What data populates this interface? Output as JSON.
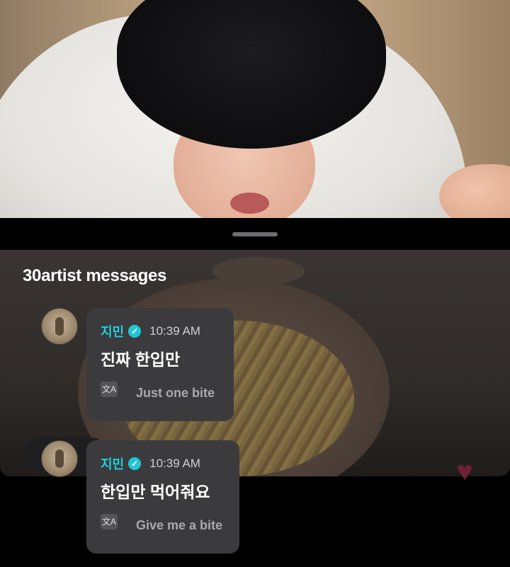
{
  "section": {
    "title": "30artist messages"
  },
  "messages": [
    {
      "sender": "지민",
      "verified_icon": "verified-badge-icon",
      "time": "10:39 AM",
      "text": "진짜 한입만",
      "translate_icon": "translate-icon",
      "translation": "Just one bite"
    },
    {
      "sender": "지민",
      "verified_icon": "verified-badge-icon",
      "time": "10:39 AM",
      "text": "한입만 먹어줘요",
      "translate_icon": "translate-icon",
      "translation": "Give me a bite"
    }
  ],
  "colors": {
    "name": "#22d0e0",
    "bubble": "#3b3b3d",
    "heart": "#6e1f3c"
  }
}
